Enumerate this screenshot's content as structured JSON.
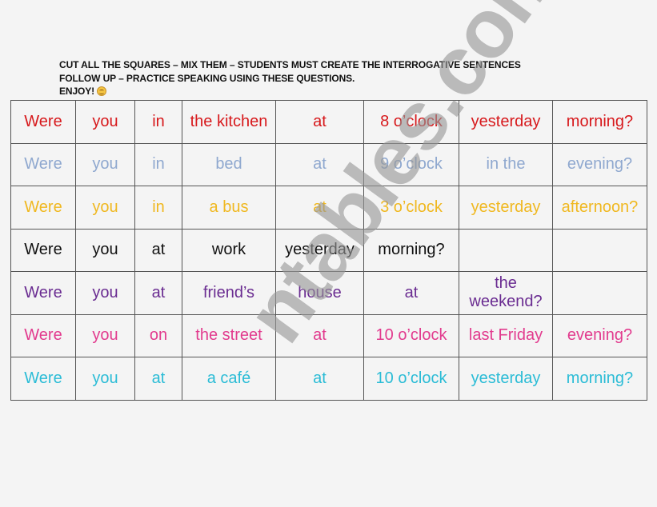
{
  "instructions": {
    "line1": "CUT ALL THE SQUARES – MIX THEM – STUDENTS MUST CREATE THE INTERROGATIVE SENTENCES",
    "line2": "FOLLOW UP – PRACTICE SPEAKING USING THESE QUESTIONS.",
    "line3": "ENJOY!",
    "emoji_icon": "smiling-face-icon"
  },
  "rows": [
    {
      "color": "#d7191c",
      "cells": [
        "Were",
        "you",
        "in",
        "the kitchen",
        "at",
        "8 o’clock",
        "yesterday",
        "morning?"
      ]
    },
    {
      "color": "#8fa8cf",
      "cells": [
        "Were",
        "you",
        "in",
        "bed",
        "at",
        "9 o’clock",
        "in the",
        "evening?"
      ]
    },
    {
      "color": "#f0b820",
      "cells": [
        "Were",
        "you",
        "in",
        "a bus",
        "at",
        "3 o’clock",
        "yesterday",
        "afternoon?"
      ]
    },
    {
      "color": "#111111",
      "cells": [
        "Were",
        "you",
        "at",
        "work",
        "yesterday",
        "morning?",
        "",
        ""
      ]
    },
    {
      "color": "#6a2c91",
      "cells": [
        "Were",
        "you",
        "at",
        "friend’s",
        "house",
        "at",
        "the weekend?",
        ""
      ]
    },
    {
      "color": "#e23b8e",
      "cells": [
        "Were",
        "you",
        "on",
        "the street",
        "at",
        "10 o’clock",
        "last Friday",
        "evening?"
      ]
    },
    {
      "color": "#2bbcd6",
      "cells": [
        "Were",
        "you",
        "at",
        "a café",
        "at",
        "10 o’clock",
        "yesterday",
        "morning?"
      ]
    }
  ],
  "watermark": {
    "text": "ntables.com"
  }
}
